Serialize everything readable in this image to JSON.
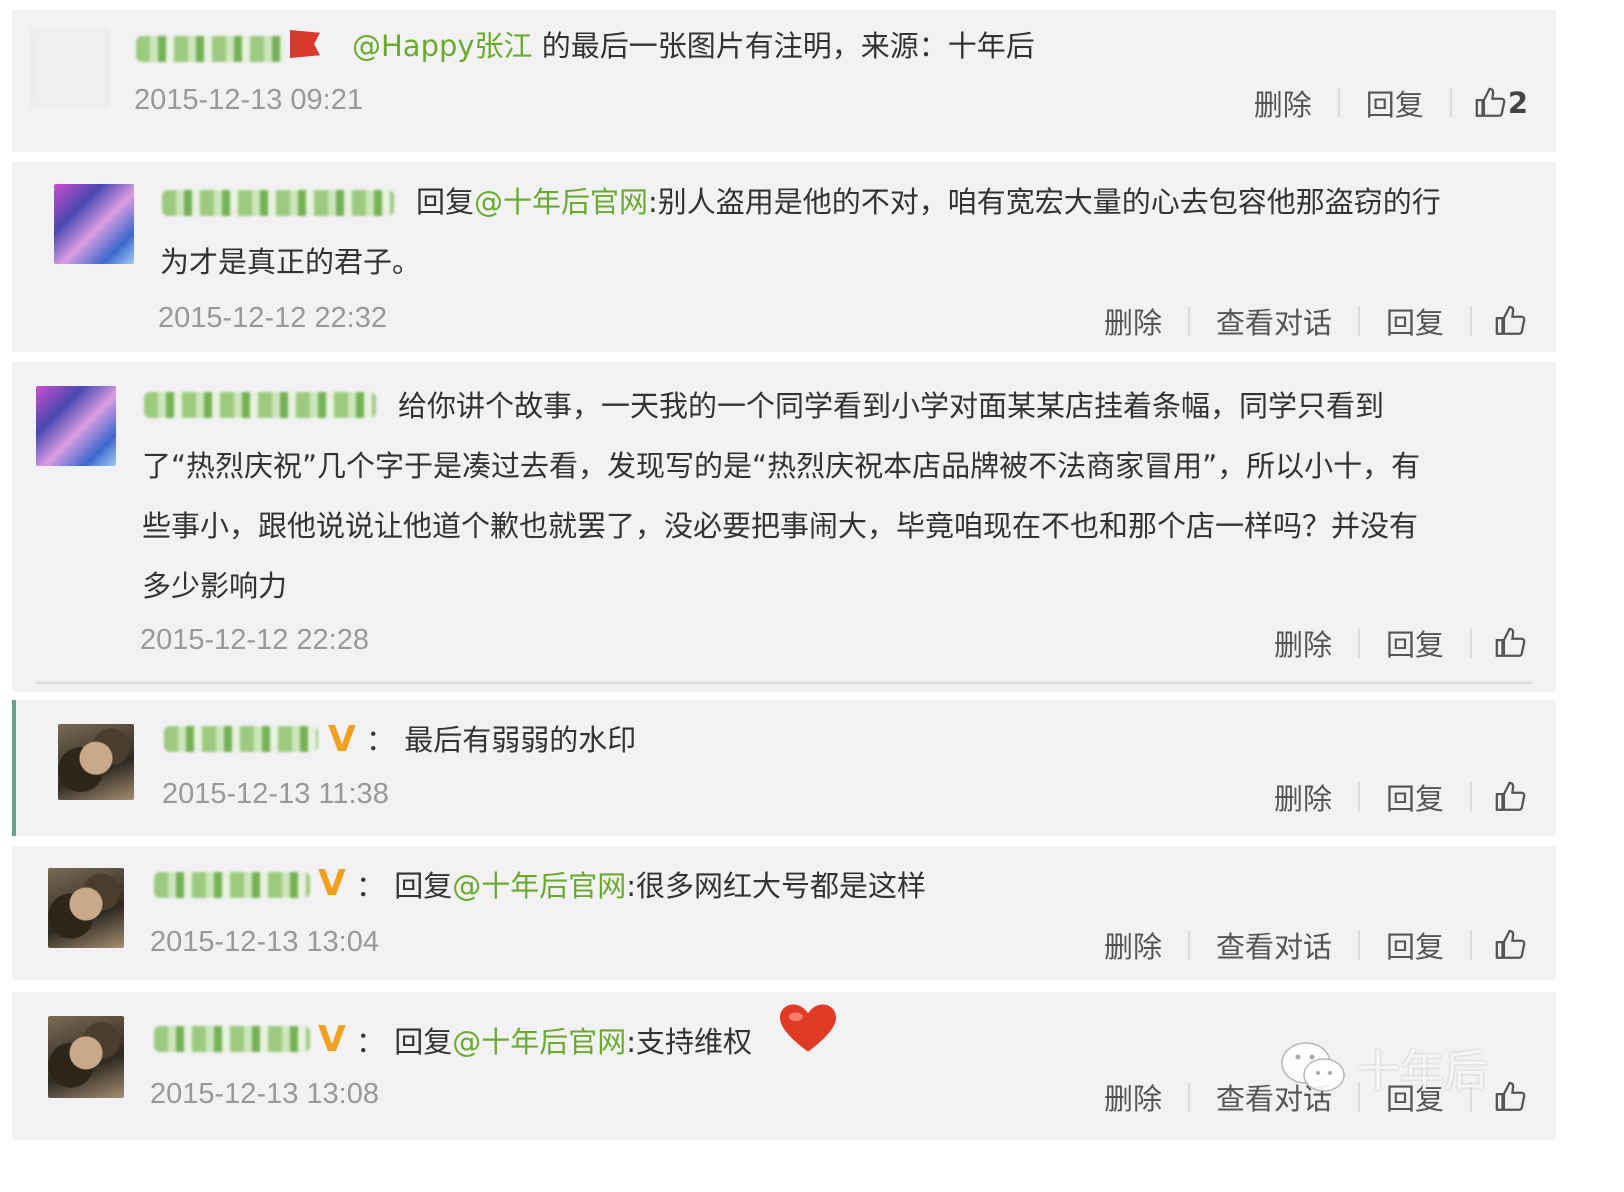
{
  "comments": [
    {
      "text_before": "",
      "mention": "@Happy张江",
      "text_after": " 的最后一张图片有注明，来源：十年后",
      "time": "2015-12-13 09:21",
      "actions": [
        "删除",
        "回复"
      ],
      "like_count": "2"
    },
    {
      "text_before": "回复",
      "mention": "@十年后官网",
      "text_line1_after": ":别人盗用是他的不对，咱有宽宏大量的心去包容他那盗窃的行",
      "text_line2": "为才是真正的君子。",
      "time": "2015-12-12 22:32",
      "actions": [
        "删除",
        "查看对话",
        "回复"
      ]
    },
    {
      "lines": [
        "给你讲个故事，一天我的一个同学看到小学对面某某店挂着条幅，同学只看到",
        "了“热烈庆祝”几个字于是凑过去看，发现写的是“热烈庆祝本店品牌被不法商家冒用”，所以小十，有",
        "些事小，跟他说说让他道个歉也就罢了，没必要把事闹大，毕竟咱现在不也和那个店一样吗？并没有",
        "多少影响力"
      ],
      "time": "2015-12-12 22:28",
      "actions": [
        "删除",
        "回复"
      ]
    },
    {
      "badge": "V",
      "text": "：  最后有弱弱的水印",
      "time": "2015-12-13 11:38",
      "actions": [
        "删除",
        "回复"
      ]
    },
    {
      "badge": "V",
      "text_before": "：  回复",
      "mention": "@十年后官网",
      "text_after": ":很多网红大号都是这样",
      "time": "2015-12-13 13:04",
      "actions": [
        "删除",
        "查看对话",
        "回复"
      ]
    },
    {
      "badge": "V",
      "text_before": "：  回复",
      "mention": "@十年后官网",
      "text_after": ":支持维权",
      "time": "2015-12-13 13:08",
      "actions": [
        "删除",
        "查看对话",
        "回复"
      ]
    }
  ],
  "watermark": {
    "text": "十年后"
  },
  "colors": {
    "mention": "#6aab2e",
    "vip": "#f1a01f",
    "time": "#999999"
  },
  "icons": [
    "thumbs-up-icon",
    "heart-icon",
    "wechat-logo-icon",
    "flag-icon"
  ]
}
